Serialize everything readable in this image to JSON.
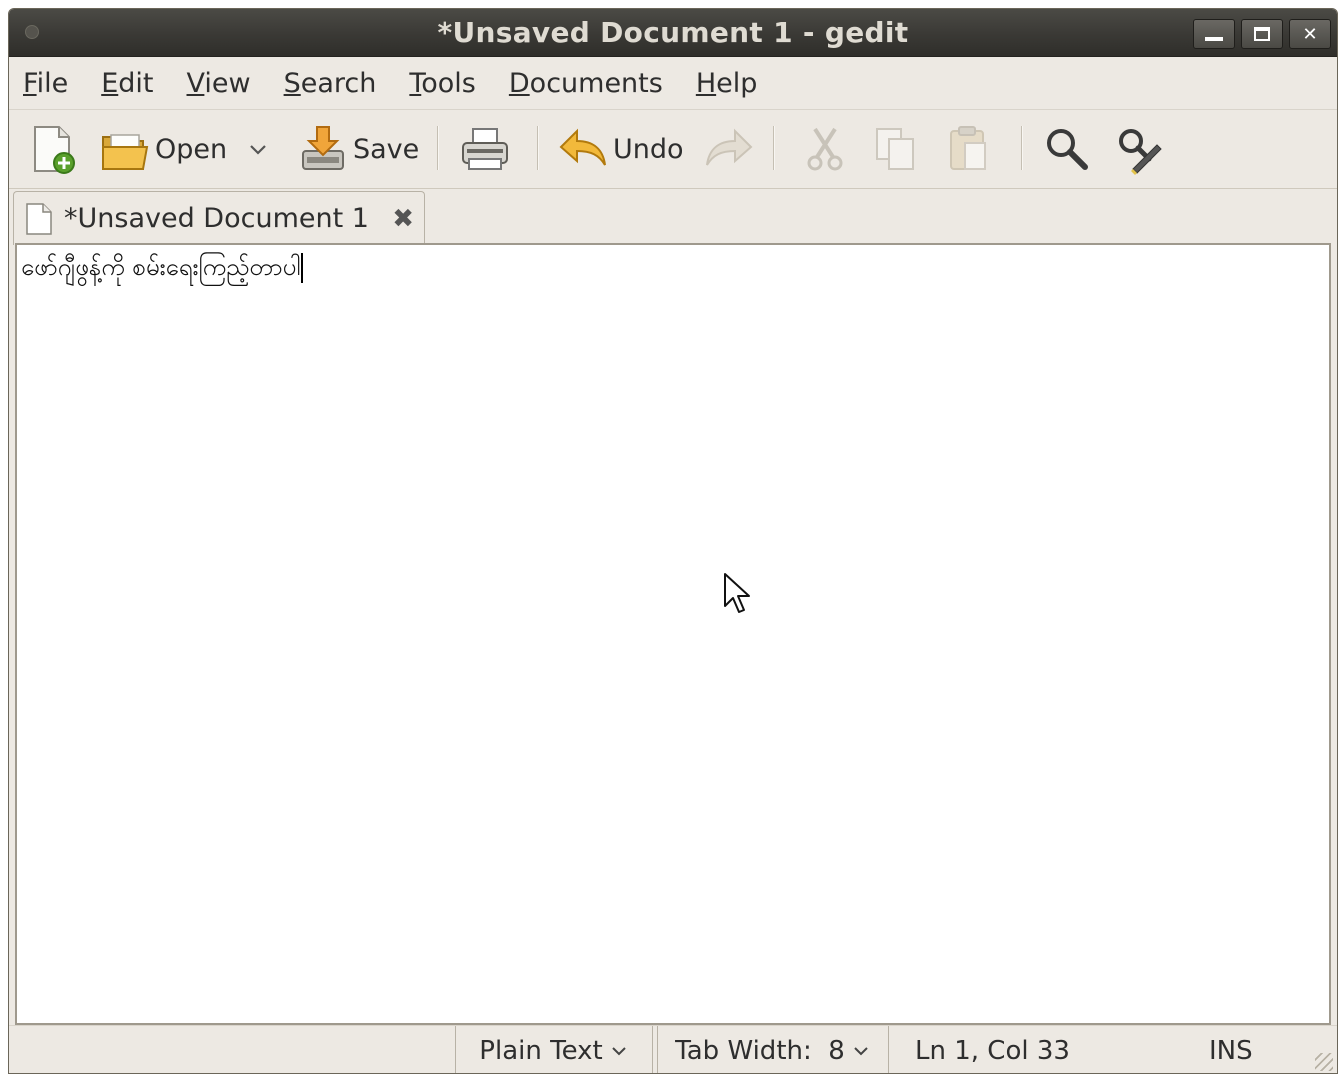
{
  "window": {
    "title": "*Unsaved Document 1 - gedit"
  },
  "menu": {
    "items": [
      {
        "label_ul": "F",
        "label_rest": "ile"
      },
      {
        "label_ul": "E",
        "label_rest": "dit"
      },
      {
        "label_ul": "V",
        "label_rest": "iew"
      },
      {
        "label_ul": "S",
        "label_rest": "earch"
      },
      {
        "label_ul": "T",
        "label_rest": "ools"
      },
      {
        "label_ul": "D",
        "label_rest": "ocuments"
      },
      {
        "label_ul": "H",
        "label_rest": "elp"
      }
    ]
  },
  "toolbar": {
    "open_label": "Open",
    "save_label": "Save",
    "undo_label": "Undo"
  },
  "tab": {
    "label": "*Unsaved Document 1"
  },
  "editor": {
    "text": "ဖော်ဂျီဖွန့်ကို စမ်းရေးကြည့်တာပါ"
  },
  "statusbar": {
    "language": "Plain Text",
    "tab_width": "Tab Width:  8",
    "position": "Ln 1, Col 33",
    "mode": "INS"
  }
}
